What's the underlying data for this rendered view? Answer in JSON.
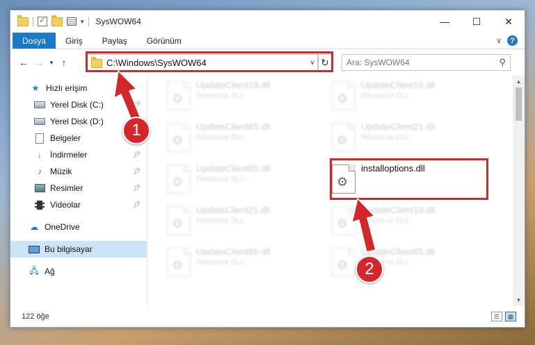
{
  "window": {
    "title": "SysWOW64",
    "controls": {
      "minimize": "—",
      "maximize": "☐",
      "close": "✕"
    }
  },
  "ribbon": {
    "tabs": [
      "Dosya",
      "Giriş",
      "Paylaş",
      "Görünüm"
    ]
  },
  "address": {
    "path": "C:\\Windows\\SysWOW64",
    "search_placeholder": "Ara: SysWOW64"
  },
  "sidebar": {
    "items": [
      {
        "label": "Hızlı erişim",
        "icon": "star-icon"
      },
      {
        "label": "Yerel Disk (C:)",
        "icon": "disk-icon",
        "pinned": true
      },
      {
        "label": "Yerel Disk (D:)",
        "icon": "disk-icon"
      },
      {
        "label": "Belgeler",
        "icon": "document-icon"
      },
      {
        "label": "İndirmeler",
        "icon": "download-icon",
        "pinned": true
      },
      {
        "label": "Müzik",
        "icon": "music-icon",
        "pinned": true
      },
      {
        "label": "Resimler",
        "icon": "pictures-icon",
        "pinned": true
      },
      {
        "label": "Videolar",
        "icon": "videos-icon",
        "pinned": true
      },
      {
        "label": "OneDrive",
        "icon": "cloud-icon"
      },
      {
        "label": "Bu bilgisayar",
        "icon": "computer-icon",
        "selected": true
      },
      {
        "label": "Ağ",
        "icon": "network-icon"
      }
    ]
  },
  "files": [
    {
      "name": "UpdateClient19.dll",
      "type": "Resource DLL"
    },
    {
      "name": "UpdateClient19.dll",
      "type": "Resource DLL"
    },
    {
      "name": "UpdateClient65.dll",
      "type": "Resource DLL"
    },
    {
      "name": "UpdateClient21.dll",
      "type": "Resource DLL"
    },
    {
      "name": "UpdateClient65.dll",
      "type": "Resource DLL"
    },
    {
      "name": "installoptions.dll",
      "type": ""
    },
    {
      "name": "UpdateClient21.dll",
      "type": "Resource DLL"
    },
    {
      "name": "UpdateClient19.dll",
      "type": "Resource DLL"
    },
    {
      "name": "UpdateClient65.dll",
      "type": "Resource DLL"
    },
    {
      "name": "UpdateClient65.dll",
      "type": "Resource DLL"
    }
  ],
  "status": {
    "item_count": "122 öğe"
  },
  "callouts": {
    "step1": "1",
    "step2": "2"
  },
  "colors": {
    "accent": "#1979ca",
    "highlight": "#d3272a",
    "selected_bg": "#cce4f7"
  }
}
